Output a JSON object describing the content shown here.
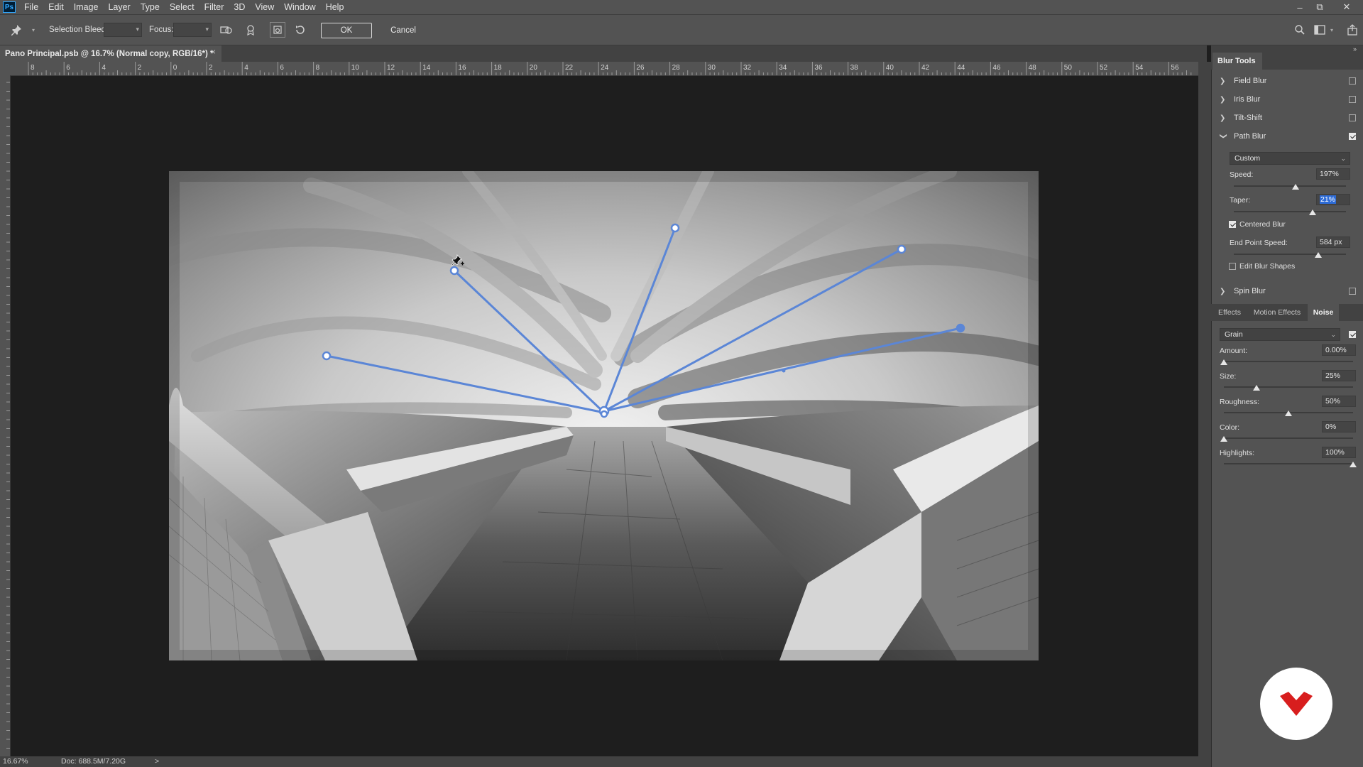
{
  "menu": {
    "logo": "Ps",
    "items": [
      "File",
      "Edit",
      "Image",
      "Layer",
      "Type",
      "Select",
      "Filter",
      "3D",
      "View",
      "Window",
      "Help"
    ]
  },
  "options_bar": {
    "selection_bleed_label": "Selection Bleed:",
    "focus_label": "Focus:",
    "ok_label": "OK",
    "cancel_label": "Cancel"
  },
  "document": {
    "tab_title": "Pano Principal.psb @ 16.7% (Normal copy, RGB/16*) *",
    "close_glyph": "×"
  },
  "ruler": {
    "ticks": [
      "8",
      "6",
      "4",
      "2",
      "0",
      "2",
      "4",
      "6",
      "8",
      "10",
      "12",
      "14",
      "16",
      "18",
      "20",
      "22",
      "24",
      "26",
      "28",
      "30",
      "32",
      "34",
      "36",
      "38",
      "40",
      "42",
      "44",
      "46",
      "48",
      "50",
      "52",
      "54",
      "56"
    ]
  },
  "status": {
    "zoom": "16.67%",
    "doc": "Doc: 688.5M/7.20G",
    "arrow": ">"
  },
  "panel": {
    "tab_label": "Blur Tools",
    "sections": [
      {
        "label": "Field Blur",
        "checked": false
      },
      {
        "label": "Iris Blur",
        "checked": false
      },
      {
        "label": "Tilt-Shift",
        "checked": false
      },
      {
        "label": "Path Blur",
        "checked": true
      },
      {
        "label": "Spin Blur",
        "checked": false
      }
    ],
    "path_blur": {
      "preset": "Custom",
      "speed_label": "Speed:",
      "speed_value": "197%",
      "speed_level": 0.55,
      "taper_label": "Taper:",
      "taper_value": "21%",
      "taper_level": 0.7,
      "centered_blur_label": "Centered Blur",
      "centered_blur_checked": true,
      "end_point_speed_label": "End Point Speed:",
      "end_point_speed_value": "584 px",
      "end_point_level": 0.75,
      "edit_blur_shapes_label": "Edit Blur Shapes",
      "edit_blur_shapes_checked": false
    },
    "subtabs": [
      "Effects",
      "Motion Effects",
      "Noise"
    ],
    "active_subtab": "Noise",
    "noise": {
      "type": "Grain",
      "enabled": true,
      "amount_label": "Amount:",
      "amount_value": "0.00%",
      "amount_level": 0.0,
      "size_label": "Size:",
      "size_value": "25%",
      "size_level": 0.25,
      "roughness_label": "Roughness:",
      "roughness_value": "50%",
      "roughness_level": 0.5,
      "color_label": "Color:",
      "color_value": "0%",
      "color_level": 0.0,
      "highlights_label": "Highlights:",
      "highlights_value": "100%",
      "highlights_level": 1.0
    }
  },
  "icons": {
    "pin_tool": "pin-icon",
    "remove_pins": "remove-pins-icon",
    "save_mask": "save-mask-icon",
    "high_quality": "high-quality-icon",
    "reset": "reset-icon",
    "search": "search-icon",
    "workspace": "workspace-icon",
    "share": "share-icon"
  },
  "colors": {
    "path_line": "#5b86d6",
    "logo_accent": "#d81e1e"
  }
}
